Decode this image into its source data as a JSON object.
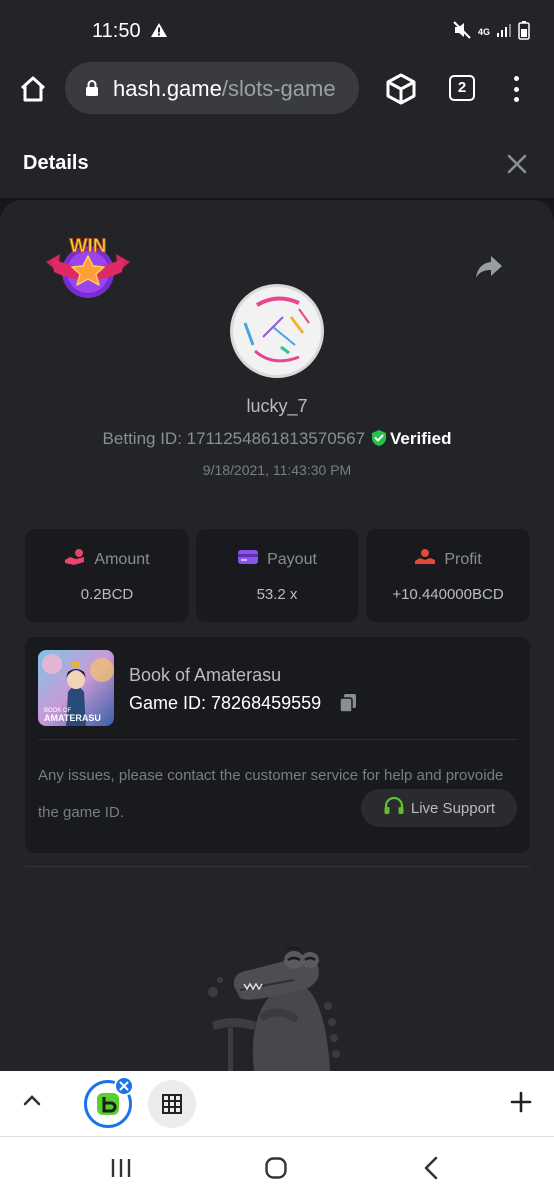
{
  "status_bar": {
    "time": "11:50",
    "network": "4G",
    "icons": [
      "warning-icon",
      "mute-icon",
      "signal-icon",
      "battery-icon"
    ]
  },
  "browser": {
    "url_host": "hash.game",
    "url_path": "/slots-game",
    "tab_count": "2",
    "icons": [
      "home-icon",
      "lock-icon",
      "cube-icon",
      "more-vert-icon"
    ]
  },
  "header": {
    "title": "Details",
    "close_icon": "close-icon"
  },
  "bet": {
    "username": "lucky_7",
    "betting_id_label": "Betting ID: 1711254861813570567",
    "verified_label": "Verified",
    "datetime": "9/18/2021, 11:43:30 PM",
    "win_badge": "WIN"
  },
  "stats": {
    "amount": {
      "label": "Amount",
      "value": "0.2BCD",
      "color": "#e8456b"
    },
    "payout": {
      "label": "Payout",
      "value": "53.2 x",
      "color": "#8b54e8"
    },
    "profit": {
      "label": "Profit",
      "value": "+10.440000BCD",
      "color": "#e04a3c"
    }
  },
  "game": {
    "name": "Book of Amaterasu",
    "game_id_label": "Game ID: 78268459559",
    "thumb_text_1": "BOOK OF",
    "thumb_text_2": "AMATERASU",
    "issue_text": "Any issues, please contact the customer service for help and provoide the game ID.",
    "support_label": "Live Support"
  },
  "colors": {
    "background": "#17181b",
    "panel": "#232427",
    "card": "#191a1d",
    "verified_green": "#27c24c",
    "support_green": "#5fbf2f"
  }
}
